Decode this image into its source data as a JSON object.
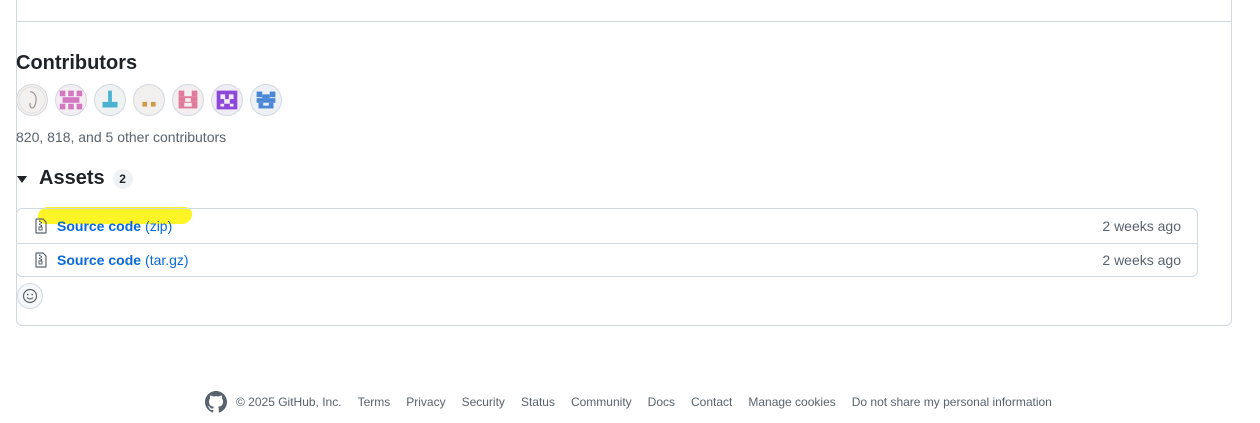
{
  "contributors": {
    "title": "Contributors",
    "avatars": [
      {
        "name": "avatar-1",
        "color": "#c9c0ba"
      },
      {
        "name": "avatar-2",
        "color": "#d279c2"
      },
      {
        "name": "avatar-3",
        "color": "#4bb3cf"
      },
      {
        "name": "avatar-4",
        "color": "#cf9a47"
      },
      {
        "name": "avatar-5",
        "color": "#e07b9b"
      },
      {
        "name": "avatar-6",
        "color": "#8d47d9"
      },
      {
        "name": "avatar-7",
        "color": "#4a87d6"
      }
    ],
    "summary": "820, 818, and 5 other contributors"
  },
  "assets": {
    "title": "Assets",
    "count": "2",
    "items": [
      {
        "name": "Source code",
        "ext": "(zip)",
        "time": "2 weeks ago"
      },
      {
        "name": "Source code",
        "ext": "(tar.gz)",
        "time": "2 weeks ago"
      }
    ]
  },
  "footer": {
    "copyright": "© 2025 GitHub, Inc.",
    "links": [
      "Terms",
      "Privacy",
      "Security",
      "Status",
      "Community",
      "Docs",
      "Contact",
      "Manage cookies",
      "Do not share my personal information"
    ]
  },
  "colors": {
    "link": "#0969da",
    "muted": "#59636e",
    "border": "#d1d9e0",
    "highlight": "#fff200"
  }
}
